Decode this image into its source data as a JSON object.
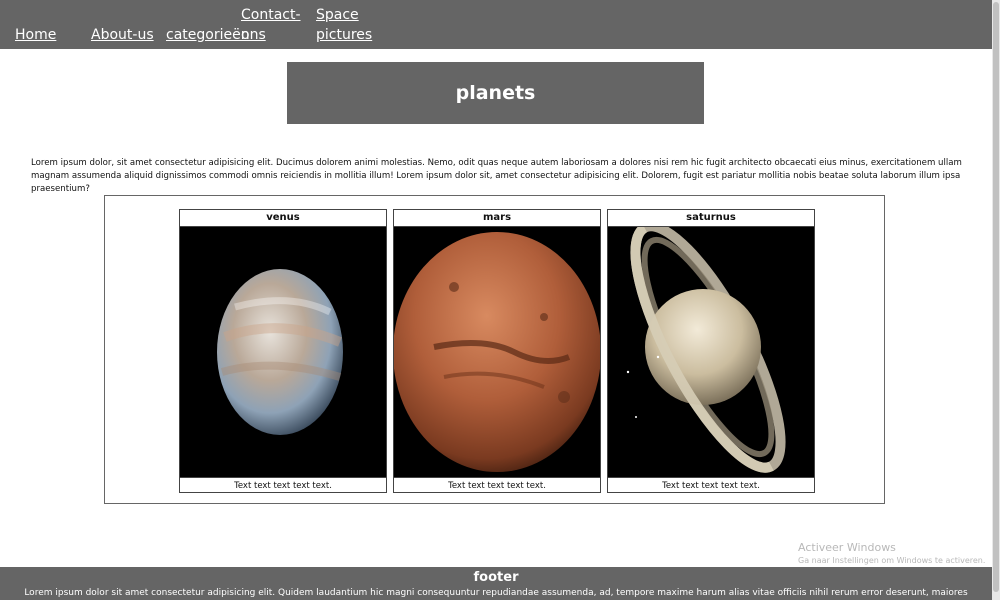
{
  "nav": {
    "items": [
      "Home",
      "About-us",
      "categorieën",
      "Contact-ons",
      "Space pictures"
    ]
  },
  "banner": {
    "title": "planets"
  },
  "intro": {
    "text": "Lorem ipsum dolor, sit amet consectetur adipisicing elit. Ducimus dolorem animi molestias. Nemo, odit quas neque autem laboriosam a dolores nisi rem hic fugit architecto obcaecati eius minus, exercitationem ullam magnam assumenda aliquid dignissimos commodi omnis reiciendis in mollitia illum! Lorem ipsum dolor sit, amet consectetur adipisicing elit. Dolorem, fugit est pariatur mollitia nobis beatae soluta laborum illum ipsa praesentium?"
  },
  "gallery": {
    "cards": [
      {
        "title": "venus",
        "caption": "Text text text text text.",
        "image": "venus-image"
      },
      {
        "title": "mars",
        "caption": "Text text text text text.",
        "image": "mars-image"
      },
      {
        "title": "saturnus",
        "caption": "Text text text text text.",
        "image": "saturn-image"
      }
    ]
  },
  "watermark": {
    "line1": "Activeer Windows",
    "line2": "Ga naar Instellingen om Windows te activeren."
  },
  "footer": {
    "title": "footer",
    "text": "Lorem ipsum dolor sit amet consectetur adipisicing elit. Quidem laudantium hic magni consequuntur repudiandae assumenda, ad, tempore maxime harum alias vitae officiis nihil rerum error deserunt, maiores perferendis minus cum!"
  },
  "colors": {
    "bar_gray": "#656565",
    "page_bg": "#ffffff"
  }
}
